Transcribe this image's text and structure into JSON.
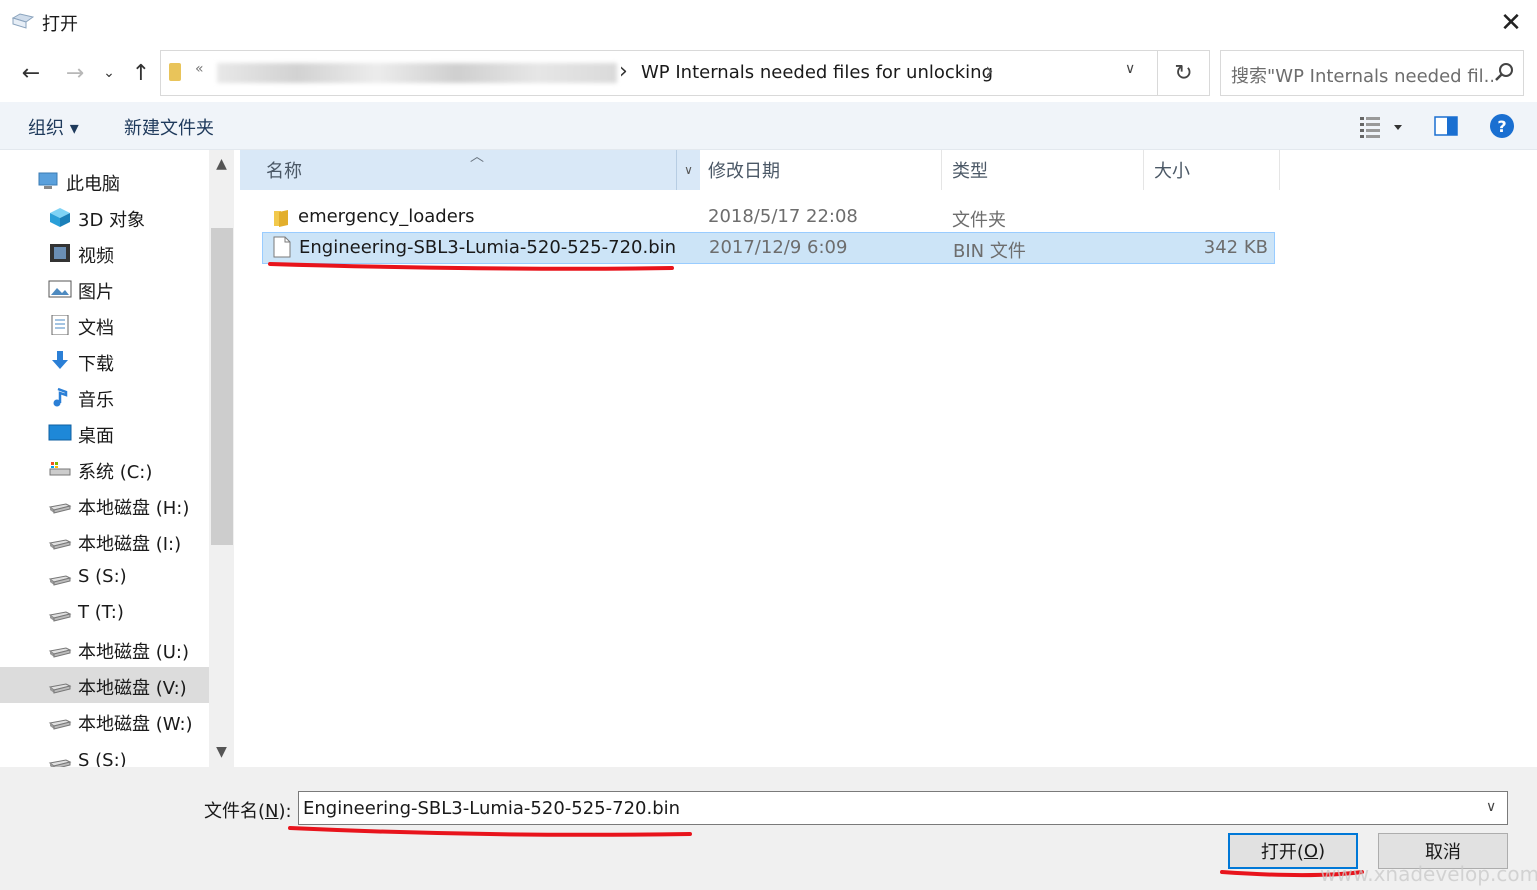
{
  "window": {
    "title": "打开",
    "title_icon": "open-dialog-icon",
    "close_icon": "close-icon"
  },
  "nav": {
    "address_prefix": "«",
    "address_path": "WP Internals needed files for unlocking",
    "search_placeholder": "搜索\"WP Internals needed fil...",
    "icons": [
      "back-arrow-icon",
      "forward-arrow-icon",
      "chevron-down-icon",
      "up-arrow-icon",
      "refresh-icon",
      "search-icon"
    ]
  },
  "toolbar": {
    "organize_label": "组织 ▾",
    "new_folder_label": "新建文件夹",
    "help_label": "?"
  },
  "sidebar": {
    "items": [
      {
        "label": "此电脑",
        "icon": "computer-icon"
      },
      {
        "label": "3D 对象",
        "icon": "3d-objects-icon"
      },
      {
        "label": "视频",
        "icon": "video-icon"
      },
      {
        "label": "图片",
        "icon": "pictures-icon"
      },
      {
        "label": "文档",
        "icon": "documents-icon"
      },
      {
        "label": "下载",
        "icon": "download-icon"
      },
      {
        "label": "音乐",
        "icon": "music-icon"
      },
      {
        "label": "桌面",
        "icon": "desktop-icon"
      },
      {
        "label": "系统 (C:)",
        "icon": "system-drive-icon"
      },
      {
        "label": "本地磁盘 (H:)",
        "icon": "drive-icon"
      },
      {
        "label": "本地磁盘 (I:)",
        "icon": "drive-icon"
      },
      {
        "label": "S (S:)",
        "icon": "drive-icon"
      },
      {
        "label": "T (T:)",
        "icon": "drive-icon"
      },
      {
        "label": "本地磁盘 (U:)",
        "icon": "drive-icon"
      },
      {
        "label": "本地磁盘 (V:)",
        "icon": "drive-icon",
        "selected": true
      },
      {
        "label": "本地磁盘 (W:)",
        "icon": "drive-icon"
      },
      {
        "label": "S (S:)",
        "icon": "drive-icon"
      }
    ]
  },
  "filelist": {
    "headers": {
      "name": "名称",
      "date": "修改日期",
      "type": "类型",
      "size": "大小"
    },
    "rows": [
      {
        "name": "emergency_loaders",
        "date": "2018/5/17 22:08",
        "type": "文件夹",
        "size": "",
        "icon": "folder-icon"
      },
      {
        "name": "Engineering-SBL3-Lumia-520-525-720.bin",
        "date": "2017/12/9 6:09",
        "type": "BIN 文件",
        "size": "342 KB",
        "icon": "file-icon",
        "selected": true
      }
    ]
  },
  "footer": {
    "filename_label_pre": "文件名(",
    "filename_label_key": "N",
    "filename_label_post": "):",
    "filename_value": "Engineering-SBL3-Lumia-520-525-720.bin",
    "open_label_pre": "打开(",
    "open_label_key": "O",
    "open_label_post": ")",
    "cancel_label": "取消"
  },
  "colors": {
    "accent": "#0078d7",
    "selection": "#cce4f7",
    "annotation": "#e8141c"
  },
  "watermark": "www.xnadevelop.com"
}
